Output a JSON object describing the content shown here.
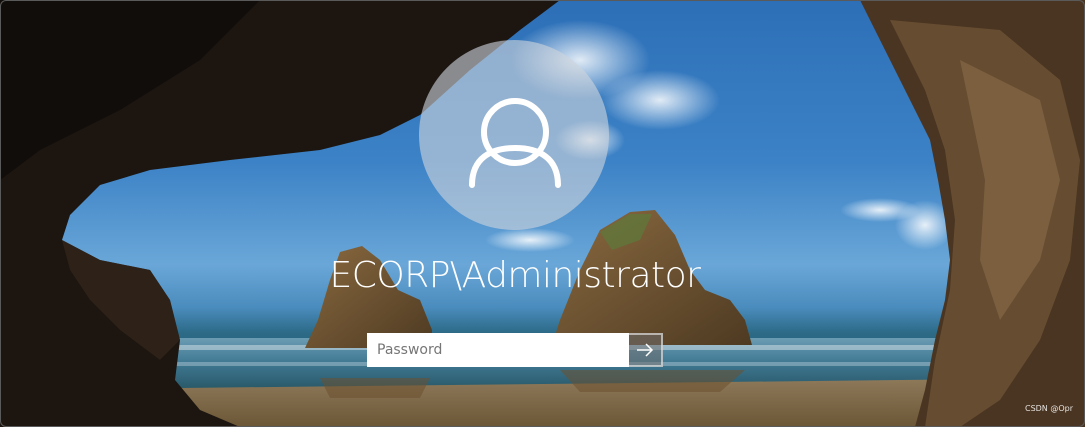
{
  "lock_screen": {
    "username": "ECORP\\Administrator",
    "password_placeholder": "Password",
    "submit_icon": "arrow-right-icon",
    "avatar_icon": "user-icon"
  },
  "watermark": {
    "text": "CSDN @Opr"
  },
  "colors": {
    "avatar_background": "#cdd4dc",
    "input_background": "#ffffff",
    "text": "#ffffff"
  }
}
